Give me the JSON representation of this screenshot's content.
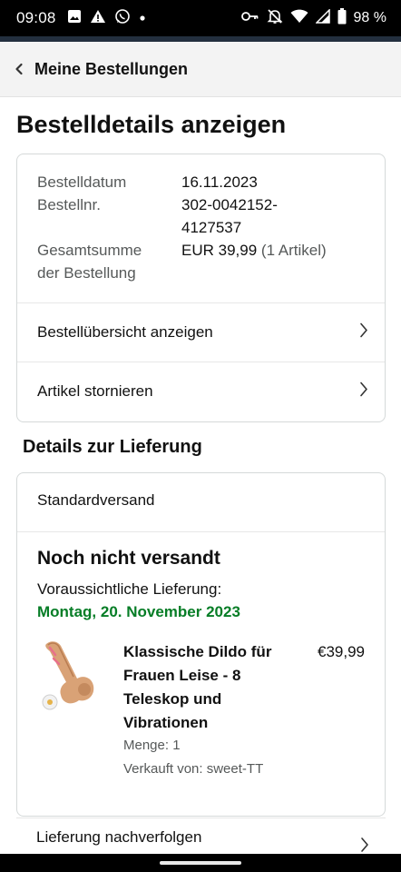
{
  "status_bar": {
    "time": "09:08",
    "battery": "98 %",
    "left_icons": [
      "image-icon",
      "warning-icon",
      "whatsapp-icon",
      "dot-icon"
    ],
    "right_icons": [
      "key-icon",
      "bell-off-icon",
      "wifi-icon",
      "signal-icon",
      "battery-icon"
    ]
  },
  "nav": {
    "back_label": "Meine Bestellungen"
  },
  "page": {
    "title": "Bestelldetails anzeigen"
  },
  "order_info": {
    "date_label": "Bestelldatum",
    "date_value": "16.11.2023",
    "number_label": "Bestellnr.",
    "number_value_line1": "302-0042152-",
    "number_value_line2": "4127537",
    "total_label_line1": "Gesamtsumme",
    "total_label_line2": "der Bestellung",
    "total_value": "EUR 39,99",
    "total_items": "(1 Artikel)"
  },
  "order_links": {
    "overview": "Bestellübersicht anzeigen",
    "cancel": "Artikel stornieren"
  },
  "delivery": {
    "section_title": "Details zur Lieferung",
    "shipping_type": "Standardversand",
    "status": "Noch nicht versandt",
    "expected_label": "Voraussichtliche Lieferung:",
    "expected_date": "Montag, 20. November 2023",
    "product": {
      "title": "Klassische Dildo für Frauen Leise - 8 Teleskop und Vibrationen",
      "price": "€39,99",
      "quantity": "Menge: 1",
      "seller": "Verkauft von: sweet-TT"
    },
    "track_label": "Lieferung nachverfolgen"
  },
  "colors": {
    "delivery_date": "#067d26",
    "nav_background": "#f3f3f3",
    "card_border": "#d5d9d9",
    "muted_text": "#565959"
  }
}
